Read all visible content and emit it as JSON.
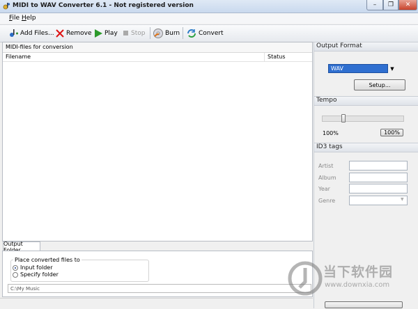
{
  "window": {
    "title": "MIDI to WAV Converter 6.1 - Not registered version",
    "min": "–",
    "max": "❐",
    "close": "✕"
  },
  "menu": {
    "file": "File",
    "help": "Help"
  },
  "toolbar": {
    "add_files": "Add Files...",
    "remove": "Remove",
    "play": "Play",
    "stop": "Stop",
    "burn": "Burn",
    "convert": "Convert"
  },
  "midi_list": {
    "title": "MIDI-files for conversion",
    "columns": [
      "Filename",
      "Status"
    ]
  },
  "output_folder": {
    "tab": "Output Folder",
    "group_label": "Place converted files to",
    "options": [
      "Input folder",
      "Specify folder"
    ],
    "selected": "Input folder",
    "path": "C:\\My Music"
  },
  "output_format": {
    "title": "Output Format",
    "value": "WAV",
    "setup": "Setup..."
  },
  "tempo": {
    "title": "Tempo",
    "value_label": "100%",
    "reset_label": "100%",
    "level": 0.25
  },
  "id3": {
    "title": "ID3 tags",
    "fields": [
      "Artist",
      "Album",
      "Year",
      "Genre"
    ]
  },
  "watermark": {
    "line1": "当下软件园",
    "line2": "www.downxia.com"
  },
  "colors": {
    "accent": "#2f6fd0",
    "close": "#c8432c"
  }
}
